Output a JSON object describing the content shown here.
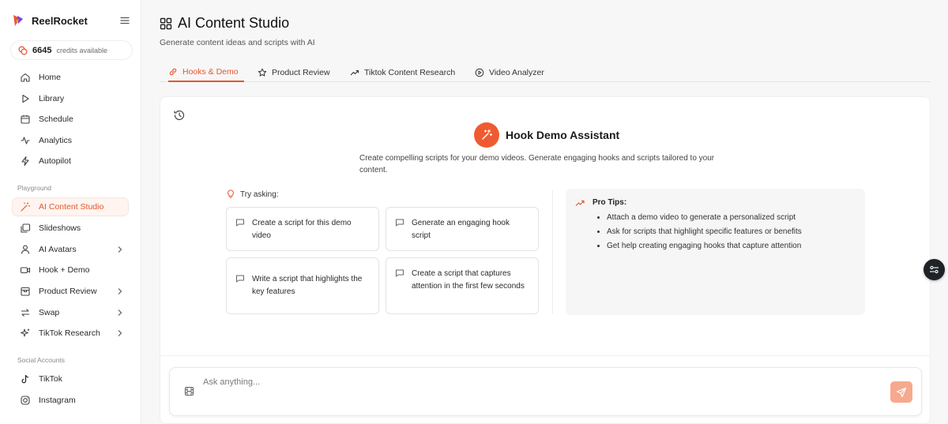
{
  "app": {
    "name": "ReelRocket"
  },
  "credits": {
    "count": "6645",
    "label": "credits available"
  },
  "sidebar": {
    "main_items": [
      {
        "label": "Home",
        "icon": "home-icon"
      },
      {
        "label": "Library",
        "icon": "play-icon"
      },
      {
        "label": "Schedule",
        "icon": "calendar-icon"
      },
      {
        "label": "Analytics",
        "icon": "activity-icon"
      },
      {
        "label": "Autopilot",
        "icon": "lightning-icon"
      }
    ],
    "playground_label": "Playground",
    "playground_items": [
      {
        "label": "AI Content Studio",
        "icon": "wand-icon",
        "active": true
      },
      {
        "label": "Slideshows",
        "icon": "slides-icon"
      },
      {
        "label": "AI Avatars",
        "icon": "user-icon",
        "has_submenu": true
      },
      {
        "label": "Hook + Demo",
        "icon": "video-icon"
      },
      {
        "label": "Product Review",
        "icon": "box-icon",
        "has_submenu": true
      },
      {
        "label": "Swap",
        "icon": "swap-icon",
        "has_submenu": true
      },
      {
        "label": "TikTok Research",
        "icon": "sparkle-icon",
        "has_submenu": true
      }
    ],
    "social_label": "Social Accounts",
    "social_items": [
      {
        "label": "TikTok",
        "icon": "tiktok-icon"
      },
      {
        "label": "Instagram",
        "icon": "instagram-icon"
      }
    ]
  },
  "header": {
    "title": "AI Content Studio",
    "subtitle": "Generate content ideas and scripts with AI"
  },
  "tabs": [
    {
      "label": "Hooks & Demo",
      "icon": "link-icon",
      "active": true
    },
    {
      "label": "Product Review",
      "icon": "star-icon"
    },
    {
      "label": "Tiktok Content Research",
      "icon": "trending-icon"
    },
    {
      "label": "Video Analyzer",
      "icon": "play-circle-icon"
    }
  ],
  "assistant": {
    "title": "Hook Demo Assistant",
    "description": "Create compelling scripts for your demo videos. Generate engaging hooks and scripts tailored to your content.",
    "try_label": "Try asking:",
    "prompts": [
      "Create a script for this demo video",
      "Generate an engaging hook script",
      "Write a script that highlights the key features",
      "Create a script that captures attention in the first few seconds"
    ]
  },
  "tips": {
    "title": "Pro Tips:",
    "items": [
      "Attach a demo video to generate a personalized script",
      "Ask for scripts that highlight specific features or benefits",
      "Get help creating engaging hooks that capture attention"
    ]
  },
  "composer": {
    "placeholder": "Ask anything..."
  },
  "colors": {
    "accent": "#e4572e",
    "accent_bg": "#fff4ef",
    "send_button": "#f6a98e"
  }
}
